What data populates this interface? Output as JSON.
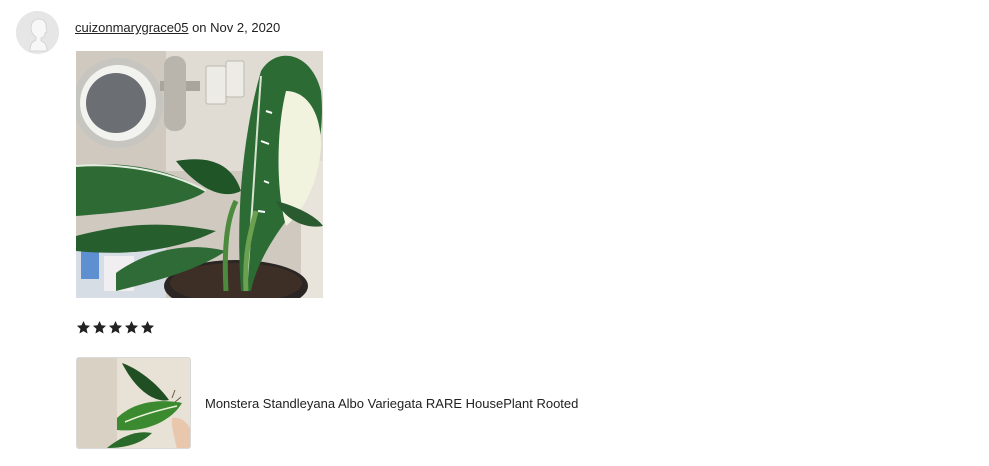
{
  "review": {
    "username": "cuizonmarygrace05",
    "date_text": "on Nov 2, 2020",
    "rating": 5,
    "rating_max": 5
  },
  "icons": {
    "avatar": "default-user-avatar-icon",
    "star": "filled-star-icon"
  },
  "listing": {
    "title": "Monstera Standleyana Albo Variegata RARE HousePlant Rooted"
  },
  "colors": {
    "text": "#222222",
    "star": "#222222",
    "avatar_bg": "#e6e6e6",
    "thumb_border": "#d9d9d9"
  }
}
